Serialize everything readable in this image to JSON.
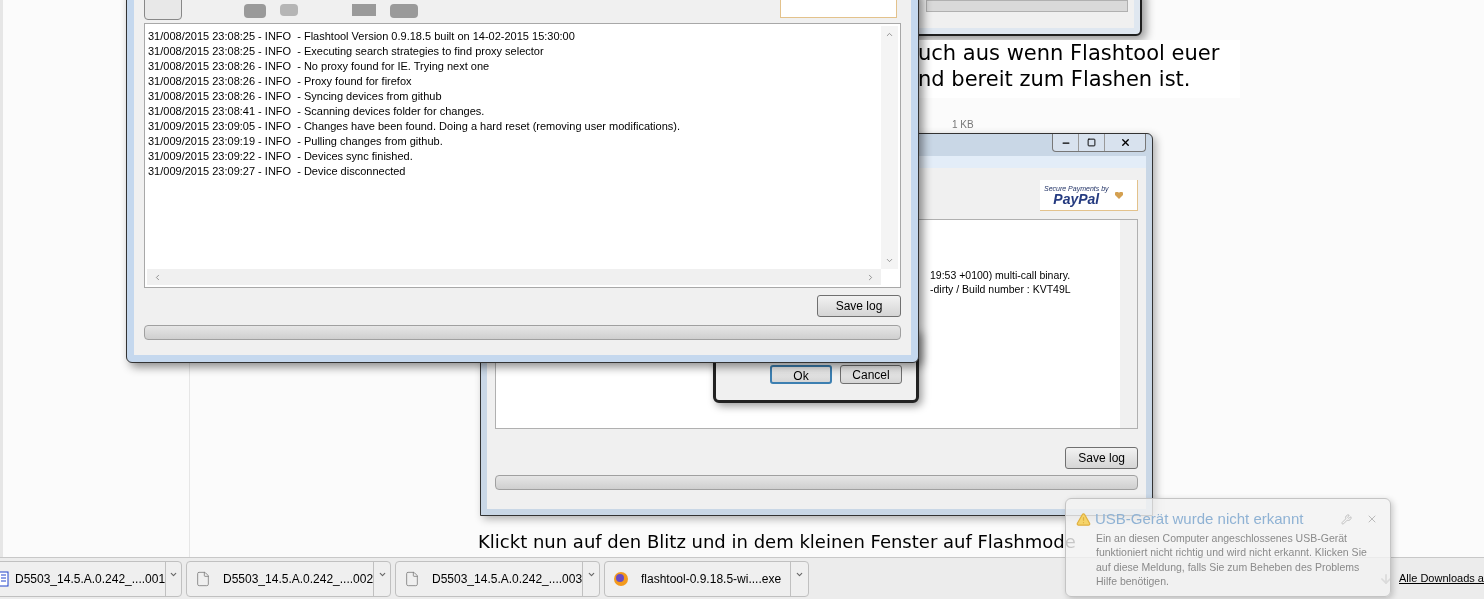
{
  "page_text": {
    "paragraph_lines": [
      "uch aus wenn Flashtool euer",
      "nd bereit zum Flashen ist."
    ],
    "file_size": "1 KB",
    "instruction": "Klickt nun auf den Blitz und in dem kleinen Fenster auf Flashmode"
  },
  "back_window": {
    "paypal": {
      "line1": "Secure Payments by",
      "line2": "PayPal"
    },
    "log_lines": [
      "19:53 +0100) multi-call binary.",
      "-dirty / Build number : KVT49L"
    ],
    "save_button": "Save log",
    "progress": {
      "level": 0
    }
  },
  "dialog": {
    "buttons": [
      {
        "label": "Ok",
        "selected": true
      },
      {
        "label": "Cancel",
        "selected": false
      }
    ]
  },
  "front_window": {
    "log_lines": [
      "31/008/2015 23:08:25 - INFO  - Flashtool Version 0.9.18.5 built on 14-02-2015 15:30:00",
      "31/008/2015 23:08:25 - INFO  - Executing search strategies to find proxy selector",
      "31/008/2015 23:08:26 - INFO  - No proxy found for IE. Trying next one",
      "31/008/2015 23:08:26 - INFO  - Proxy found for firefox",
      "31/008/2015 23:08:26 - INFO  - Syncing devices from github",
      "31/008/2015 23:08:41 - INFO  - Scanning devices folder for changes.",
      "31/009/2015 23:09:05 - INFO  - Changes have been found. Doing a hard reset (removing user modifications).",
      "31/009/2015 23:09:19 - INFO  - Pulling changes from github.",
      "31/009/2015 23:09:22 - INFO  - Devices sync finished.",
      "31/009/2015 23:09:27 - INFO  - Device disconnected"
    ],
    "save_button": "Save log",
    "progress": {
      "level": 0
    }
  },
  "downloads": [
    {
      "name": "D5503_14.5.A.0.242_....001",
      "kind": "archive"
    },
    {
      "name": "D5503_14.5.A.0.242_....002",
      "kind": "file"
    },
    {
      "name": "D5503_14.5.A.0.242_....003",
      "kind": "file"
    },
    {
      "name": "flashtool-0.9.18.5-wi....exe",
      "kind": "installer"
    }
  ],
  "show_all": "Alle Downloads a",
  "notification": {
    "title": "USB-Gerät wurde nicht erkannt",
    "body": "Ein an diesen Computer angeschlossenes USB-Gerät funktioniert nicht richtig und wird nicht erkannt. Klicken Sie auf diese Meldung, falls Sie zum Beheben des Problems Hilfe benötigen."
  }
}
